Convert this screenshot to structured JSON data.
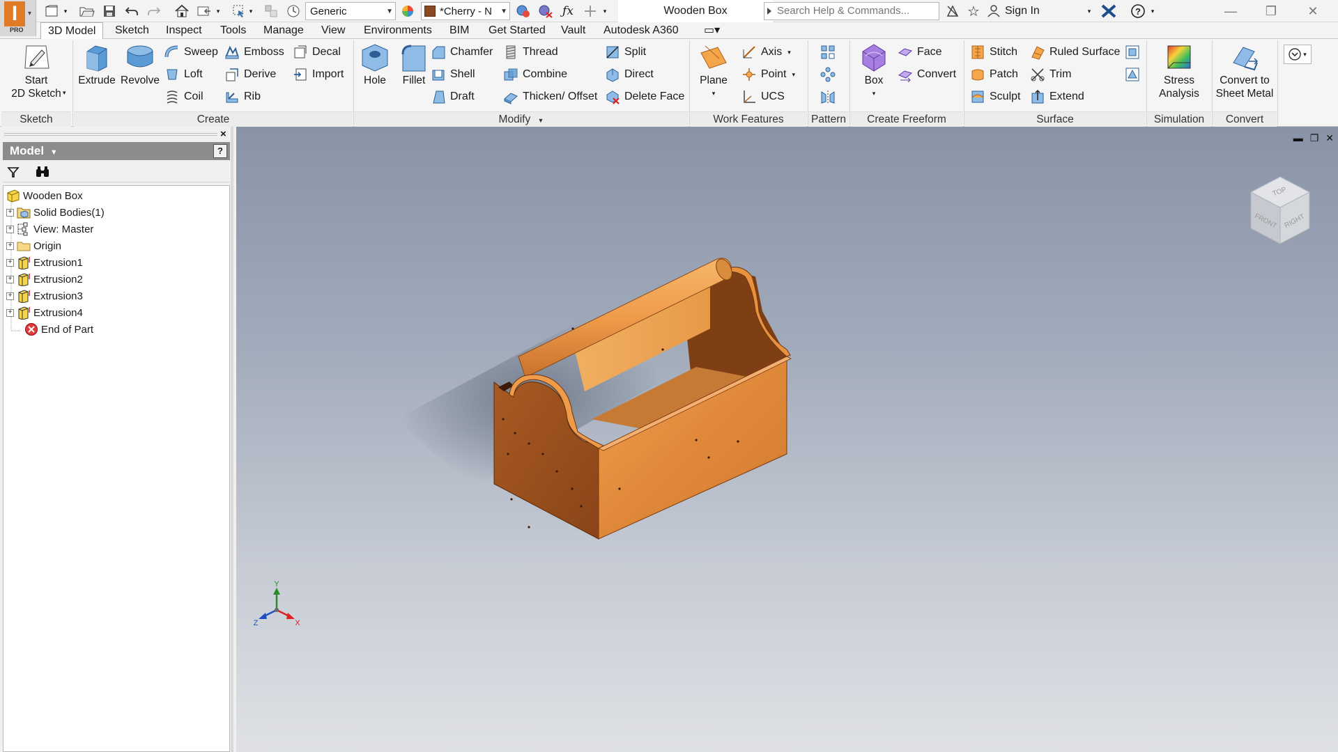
{
  "app": {
    "logo_letter": "I",
    "logo_badge": "PRO",
    "document_title": "Wooden Box",
    "search_placeholder": "Search Help & Commands...",
    "sign_in_label": "Sign In"
  },
  "quick_access": {
    "appearance_value": "Generic",
    "material_value": "*Cherry - N"
  },
  "tabs": [
    "3D Model",
    "Sketch",
    "Inspect",
    "Tools",
    "Manage",
    "View",
    "Environments",
    "BIM",
    "Get Started",
    "Vault",
    "Autodesk A360"
  ],
  "ribbon": {
    "sketch": {
      "label": "Sketch",
      "start_2d_sketch_l1": "Start",
      "start_2d_sketch_l2": "2D Sketch"
    },
    "create": {
      "label": "Create",
      "extrude": "Extrude",
      "revolve": "Revolve",
      "sweep": "Sweep",
      "loft": "Loft",
      "coil": "Coil",
      "emboss": "Emboss",
      "derive": "Derive",
      "rib": "Rib",
      "decal": "Decal",
      "import": "Import"
    },
    "modify": {
      "label": "Modify",
      "hole": "Hole",
      "fillet": "Fillet",
      "chamfer": "Chamfer",
      "shell": "Shell",
      "draft": "Draft",
      "thread": "Thread",
      "combine": "Combine",
      "thicken_offset": "Thicken/ Offset",
      "split": "Split",
      "direct": "Direct",
      "delete_face": "Delete Face"
    },
    "work_features": {
      "label": "Work Features",
      "plane": "Plane",
      "axis": "Axis",
      "point": "Point",
      "ucs": "UCS"
    },
    "pattern": {
      "label": "Pattern"
    },
    "create_freeform": {
      "label": "Create Freeform",
      "box": "Box",
      "face": "Face",
      "convert": "Convert"
    },
    "surface": {
      "label": "Surface",
      "stitch": "Stitch",
      "patch": "Patch",
      "sculpt": "Sculpt",
      "ruled_surface": "Ruled Surface",
      "trim": "Trim",
      "extend": "Extend"
    },
    "simulation": {
      "label": "Simulation",
      "stress_l1": "Stress",
      "stress_l2": "Analysis"
    },
    "convert": {
      "label": "Convert",
      "sheet_l1": "Convert to",
      "sheet_l2": "Sheet Metal"
    }
  },
  "browser": {
    "header": "Model",
    "help": "?",
    "tree": [
      {
        "label": "Wooden Box",
        "icon": "part-icon"
      },
      {
        "label": "Solid Bodies(1)",
        "icon": "solid-bodies-icon"
      },
      {
        "label": "View: Master",
        "icon": "view-icon"
      },
      {
        "label": "Origin",
        "icon": "folder-icon"
      },
      {
        "label": "Extrusion1",
        "icon": "extrusion-icon"
      },
      {
        "label": "Extrusion2",
        "icon": "extrusion-icon"
      },
      {
        "label": "Extrusion3",
        "icon": "extrusion-icon"
      },
      {
        "label": "Extrusion4",
        "icon": "extrusion-icon"
      },
      {
        "label": "End of Part",
        "icon": "end-of-part-icon"
      }
    ]
  },
  "viewcube": {
    "top": "TOP",
    "front": "FRONT",
    "right": "RIGHT"
  },
  "triad": {
    "x": "X",
    "y": "Y",
    "z": "Z"
  },
  "colors": {
    "wood": "#e08a3c",
    "wood_dark": "#9a4f1e",
    "accent_orange": "#e07a24",
    "viewport_top": "#8893a6",
    "viewport_bottom": "#dfe1e5"
  }
}
